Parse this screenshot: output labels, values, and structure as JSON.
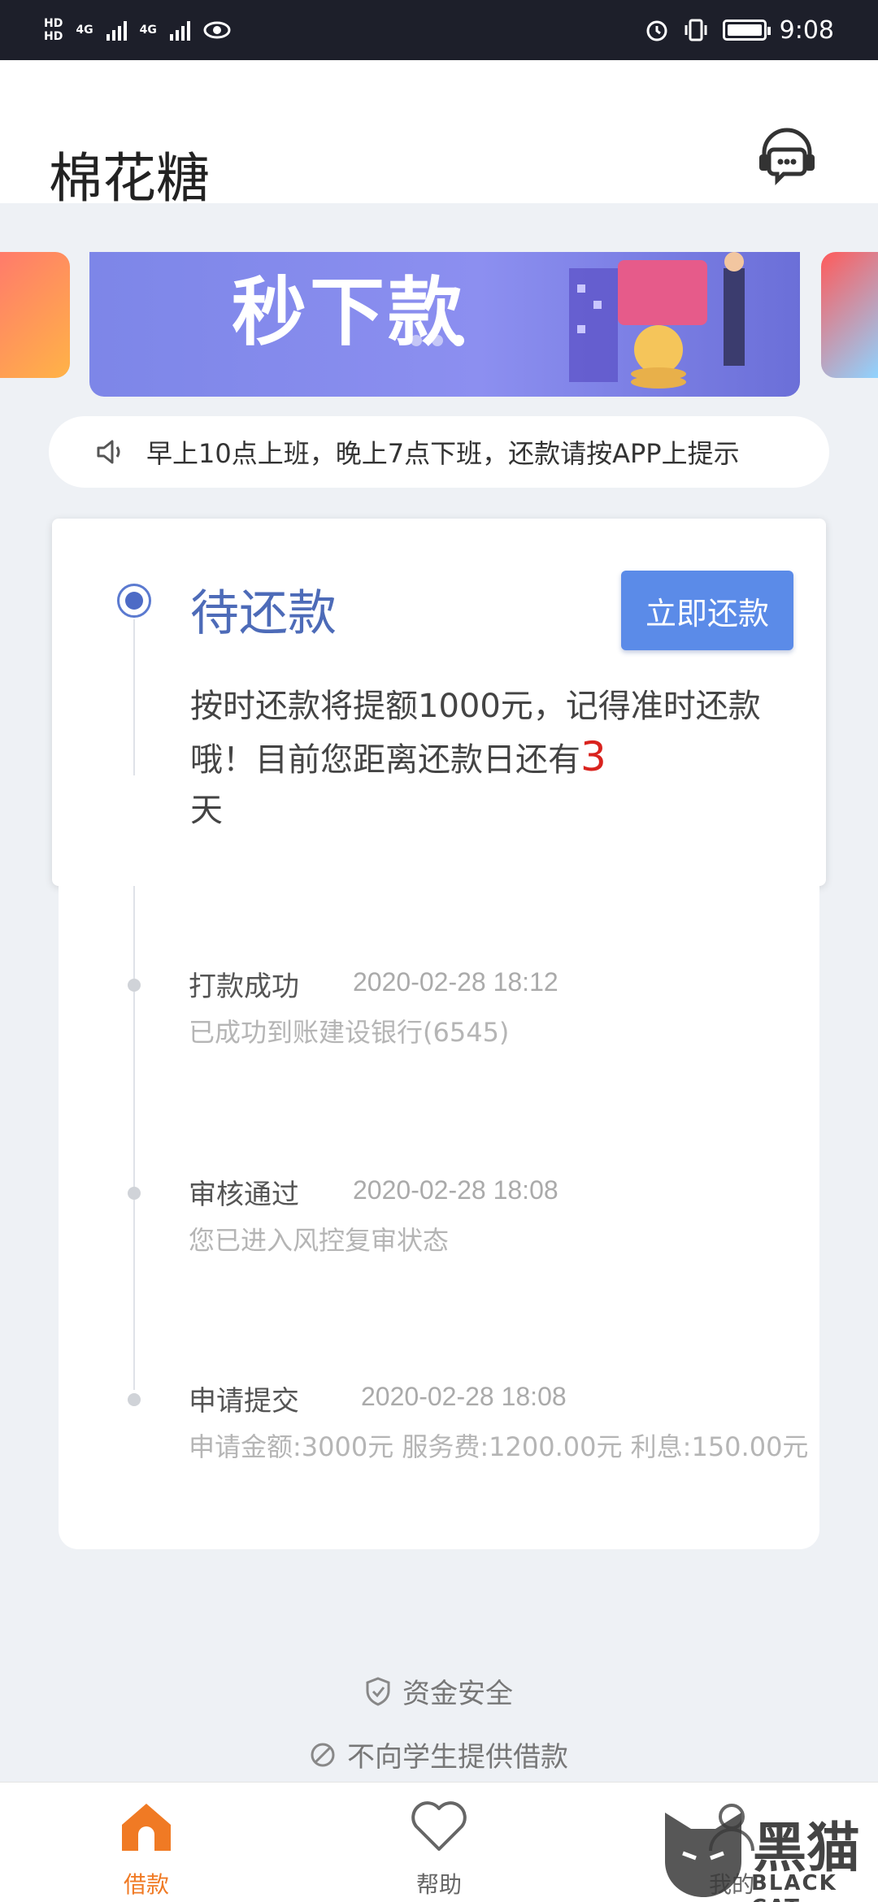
{
  "status_bar": {
    "left_labels": [
      "HD",
      "4G",
      "4G"
    ],
    "time": "9:08"
  },
  "header": {
    "title": "棉花糖"
  },
  "banner": {
    "text": "秒下款",
    "active_dot": 3,
    "dot_count": 3
  },
  "notice": {
    "text": "早上10点上班，晚上7点下班，还款请按APP上提示"
  },
  "card": {
    "status": "待还款",
    "pay_button": "立即还款",
    "message_before": "按时还款将提额1000元，记得准时还款哦！目前您距离还款日还有",
    "days": "3",
    "message_after": "天"
  },
  "timeline": [
    {
      "title": "打款成功",
      "time": "2020-02-28 18:12",
      "desc": "已成功到账建设银行(6545)"
    },
    {
      "title": "审核通过",
      "time": "2020-02-28 18:08",
      "desc": "您已进入风控复审状态"
    },
    {
      "title": "申请提交",
      "time": "2020-02-28 18:08",
      "desc": "申请金额:3000元 服务费:1200.00元 利息:150.00元"
    }
  ],
  "footer": {
    "safety": "资金安全",
    "no_student": "不向学生提供借款"
  },
  "nav": {
    "home": "借款",
    "help": "帮助",
    "me": "我的"
  },
  "watermark": {
    "text": "黑猫",
    "sub": "BLACK CAT"
  },
  "colors": {
    "accent": "#5b8be8",
    "status_blue": "#4d6bb8",
    "nav_active": "#f07a24",
    "days_red": "#d9231e"
  }
}
